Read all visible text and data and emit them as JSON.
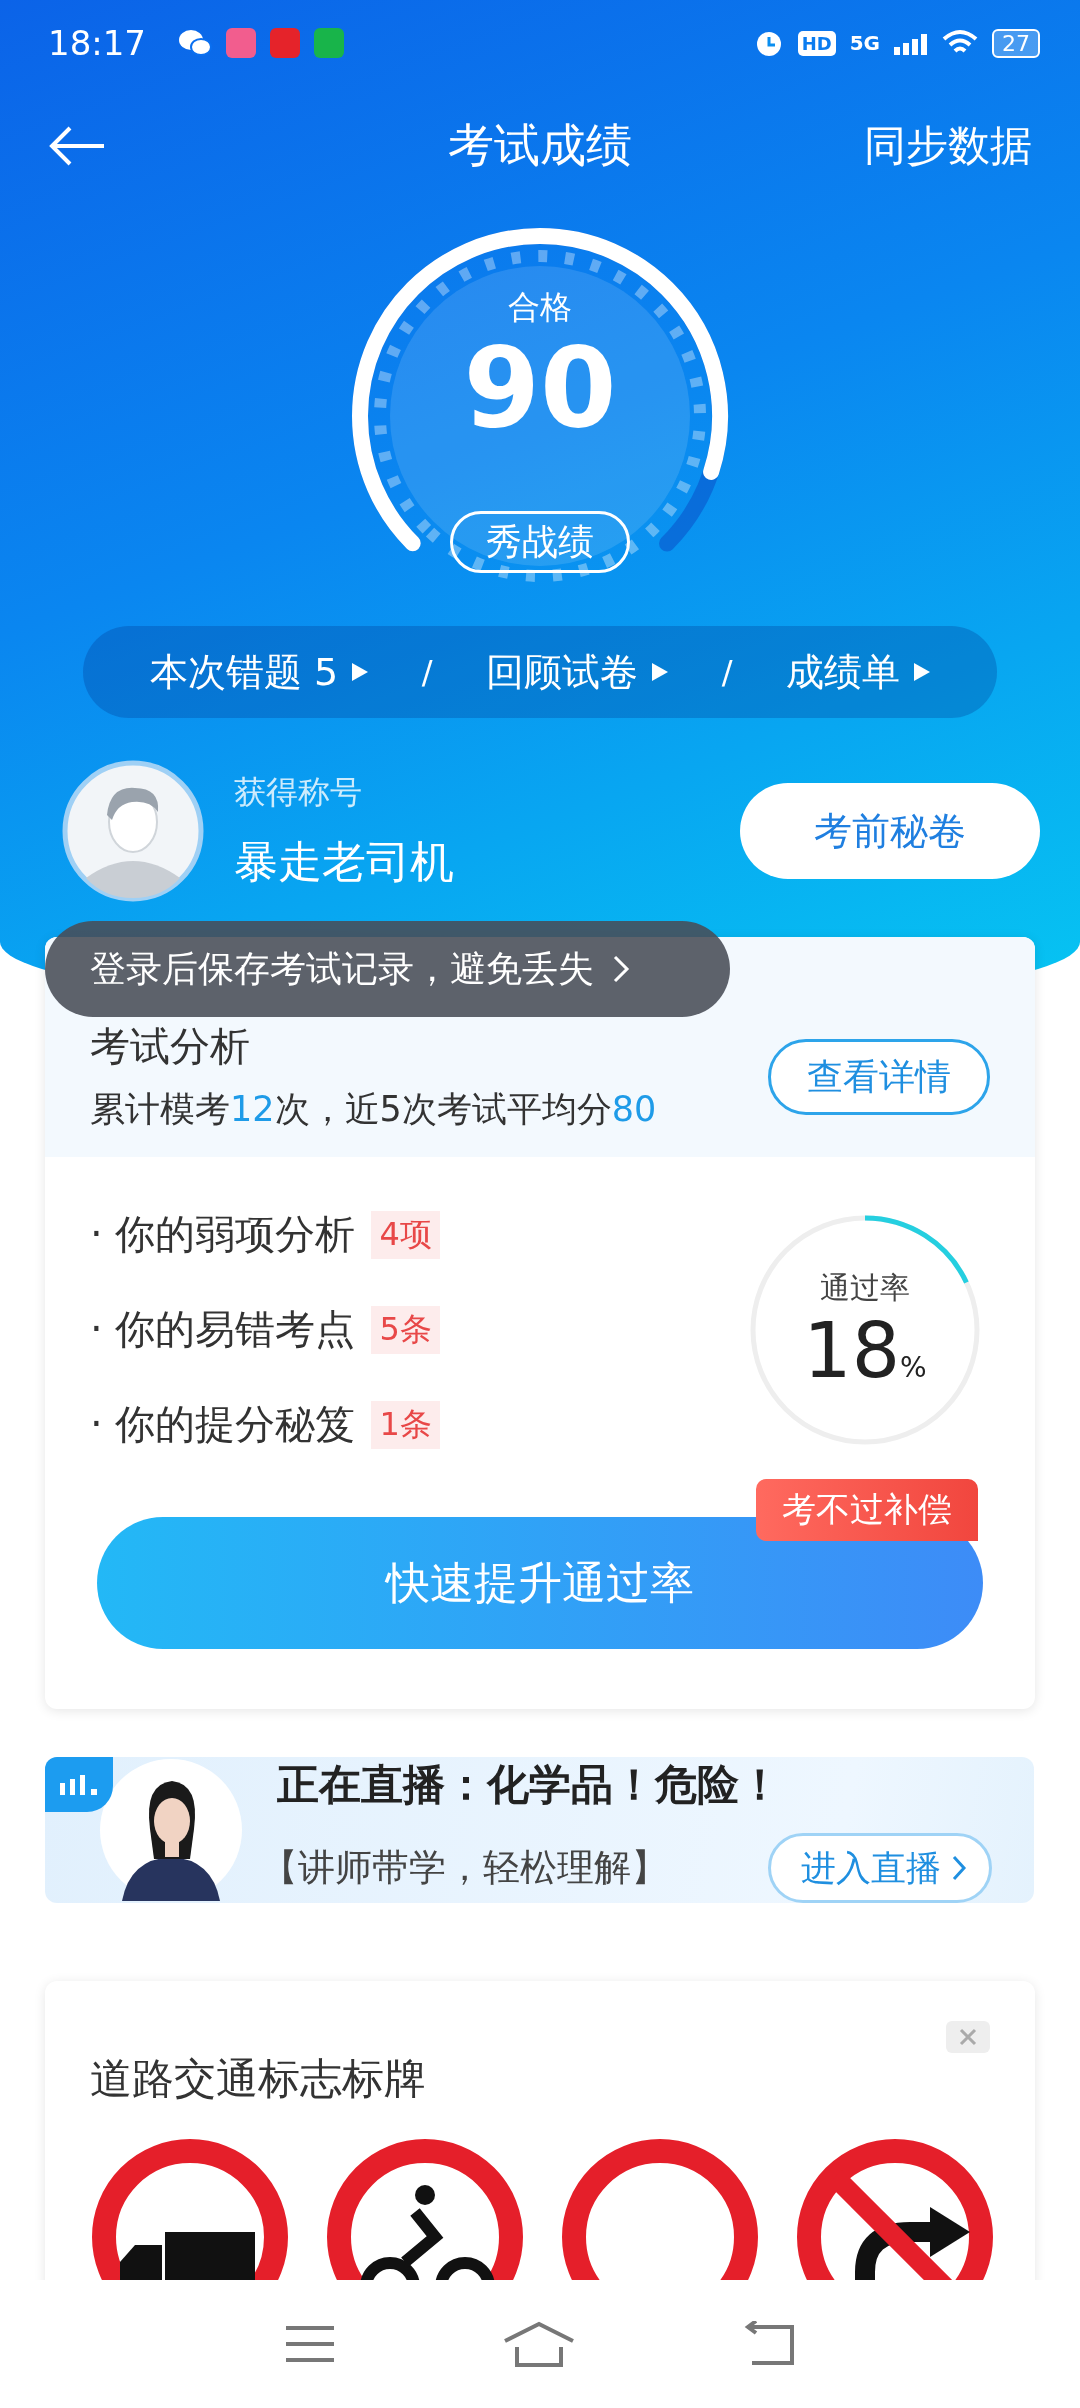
{
  "status_bar": {
    "time": "18:17",
    "network": "5G",
    "hd": "HD",
    "battery": "27"
  },
  "header": {
    "title": "考试成绩",
    "action": "同步数据"
  },
  "gauge": {
    "label": "合格",
    "score": "90",
    "share_button": "秀战绩"
  },
  "quick_links": [
    {
      "label": "本次错题",
      "count": "5"
    },
    {
      "label": "回顾试卷"
    },
    {
      "label": "成绩单"
    }
  ],
  "separators": [
    "/",
    "/"
  ],
  "profile": {
    "caption": "获得称号",
    "title": "暴走老司机",
    "button": "考前秘卷"
  },
  "tooltip": {
    "text": "登录后保存考试记录，避免丢失"
  },
  "analysis": {
    "title": "考试分析",
    "details_button": "查看详情",
    "summary": [
      {
        "text": "累计模考",
        "highlight": false
      },
      {
        "text": "12",
        "highlight": true
      },
      {
        "text": "次，近5次考试平均分",
        "highlight": false
      },
      {
        "text": "80",
        "highlight": true
      }
    ],
    "items": [
      {
        "label": "· 你的弱项分析",
        "tag": "4项"
      },
      {
        "label": "· 你的易错考点",
        "tag": "5条"
      },
      {
        "label": "· 你的提分秘笈",
        "tag": "1条"
      }
    ],
    "pass_rate": {
      "label": "通过率",
      "value": "18",
      "unit": "%"
    },
    "boost_button": "快速提升通过率",
    "badge": "考不过补偿"
  },
  "live": {
    "title": "正在直播：化学品！危险！",
    "subtitle": "【讲师带学，轻松理解】",
    "button": "进入直播"
  },
  "signs": {
    "title": "道路交通标志标牌",
    "items": [
      {
        "kind": "truck"
      },
      {
        "kind": "cyclist"
      },
      {
        "kind": "blank"
      },
      {
        "kind": "no-right-turn"
      }
    ]
  }
}
